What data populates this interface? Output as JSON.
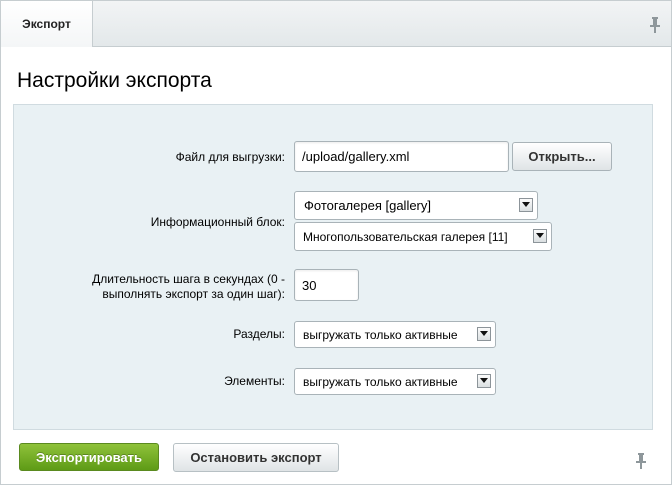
{
  "tabs": [
    {
      "label": "Экспорт",
      "active": true
    }
  ],
  "page_title": "Настройки экспорта",
  "form": {
    "file": {
      "label": "Файл для выгрузки:",
      "value": "/upload/gallery.xml",
      "open_button": "Открыть..."
    },
    "infoblock": {
      "label": "Информационный блок:",
      "type_selected": "Фотогалерея [gallery]",
      "block_selected": "Многопользовательская галерея [11]"
    },
    "step": {
      "label_line1": "Длительность шага в секундах (0 -",
      "label_line2": "выполнять экспорт за один шаг):",
      "value": "30"
    },
    "sections": {
      "label": "Разделы:",
      "selected": "выгружать только активные"
    },
    "elements": {
      "label": "Элементы:",
      "selected": "выгружать только активные"
    }
  },
  "buttons": {
    "export": "Экспортировать",
    "stop": "Остановить экспорт"
  },
  "icons": {
    "top_pin": "pin-icon",
    "bottom_pin": "pin-icon"
  },
  "colors": {
    "accent_green": "#6aa51f",
    "panel_bg": "#e9f1f4",
    "border": "#c6cdd0"
  }
}
